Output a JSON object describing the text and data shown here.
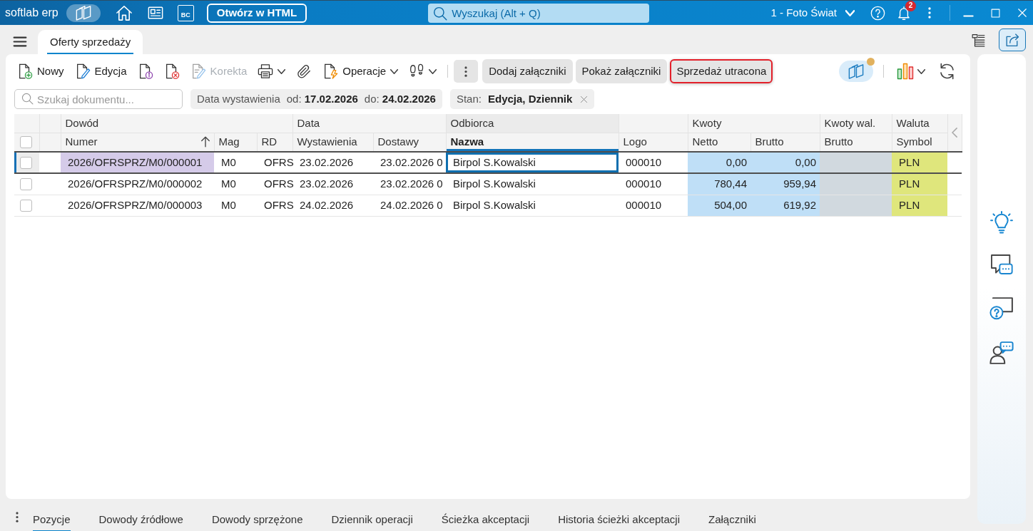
{
  "app_bar": {
    "logo": "softlab erp",
    "shortcut": "BC",
    "open_button": "Otwórz w HTML",
    "search": {
      "placeholder": "Wyszukaj (Alt + Q)"
    },
    "company": "1 - Foto Świat",
    "notification_count": "2"
  },
  "tabs": [
    {
      "label": "Oferty sprzedaży",
      "selected": true
    }
  ],
  "toolbar": {
    "tools": [
      {
        "kind": "button",
        "label": "Nowy",
        "disabled": false
      },
      {
        "kind": "button",
        "label": "Edycja",
        "disabled": false
      },
      {
        "kind": "button",
        "disabled": false
      },
      {
        "kind": "button",
        "disabled": false
      },
      {
        "kind": "button",
        "label": "Korekta",
        "disabled": true
      },
      {
        "kind": "dropdown",
        "disabled": false
      },
      {
        "kind": "button",
        "disabled": false
      },
      {
        "kind": "dropdown",
        "label": "Operacje",
        "disabled": false
      },
      {
        "kind": "dropdown",
        "disabled": false
      }
    ],
    "actions": [
      {
        "label": "Dodaj załączniki",
        "highlighted": false
      },
      {
        "label": "Pokaż załączniki",
        "highlighted": false
      },
      {
        "label": "Sprzedaż utracona",
        "highlighted": true
      }
    ]
  },
  "filter_bar": {
    "search": {
      "placeholder": "Szukaj dokumentu..."
    },
    "filters": [
      {
        "label": "Data wystawienia",
        "terms": [
          {
            "prefix": "od:",
            "value": "17.02.2026"
          },
          {
            "prefix": "do:",
            "value": "24.02.2026"
          }
        ],
        "removable": false
      },
      {
        "label": "Stan:",
        "terms": [
          {
            "value": "Edycja, Dziennik"
          }
        ],
        "removable": true
      }
    ]
  },
  "table": {
    "select_all": {
      "checked": false
    },
    "groups": [
      {
        "label": "Dowód",
        "columns": [
          {
            "label": "Numer",
            "kind": "text",
            "sorted": true,
            "focused": false
          },
          {
            "label": "Mag",
            "kind": "text",
            "sorted": false,
            "focused": false
          },
          {
            "label": "RD",
            "kind": "text",
            "sorted": false,
            "focused": false
          }
        ]
      },
      {
        "label": "Data",
        "columns": [
          {
            "label": "Wystawienia",
            "kind": "text",
            "sorted": false,
            "focused": false
          },
          {
            "label": "Dostawy",
            "kind": "text",
            "sorted": false,
            "focused": false
          }
        ]
      },
      {
        "label": "Odbiorca",
        "columns": [
          {
            "label": "Nazwa",
            "kind": "text",
            "sorted": false,
            "focused": true
          }
        ]
      },
      {
        "columns": [
          {
            "label": "Logo",
            "kind": "text",
            "sorted": false,
            "focused": false
          }
        ]
      },
      {
        "label": "Kwoty",
        "columns": [
          {
            "label": "Netto",
            "kind": "amount",
            "sorted": false,
            "focused": false,
            "color": "#bfdff7"
          },
          {
            "label": "Brutto",
            "kind": "amount",
            "sorted": false,
            "focused": false,
            "color": "#bfdff7"
          }
        ]
      },
      {
        "label": "Kwoty wal.",
        "columns": [
          {
            "label": "Brutto",
            "kind": "amount",
            "sorted": false,
            "focused": false,
            "color": "#d1d9df"
          }
        ]
      },
      {
        "label": "Waluta",
        "columns": [
          {
            "label": "Symbol",
            "kind": "text",
            "sorted": false,
            "focused": false,
            "color": "#dfe67c"
          }
        ]
      }
    ],
    "rows": [
      {
        "checked": false,
        "selected": true,
        "cells": [
          "2026/OFRSPRZ/M0/000001",
          "M0",
          "OFRS",
          "23.02.2026",
          "23.02.2026 0",
          "Birpol S.Kowalski",
          "000010",
          "0,00",
          "0,00",
          null,
          "PLN"
        ]
      },
      {
        "checked": false,
        "selected": false,
        "cells": [
          "2026/OFRSPRZ/M0/000002",
          "M0",
          "OFRS",
          "23.02.2026",
          "23.02.2026 0",
          "Birpol S.Kowalski",
          "000010",
          "780,44",
          "959,94",
          null,
          "PLN"
        ]
      },
      {
        "checked": false,
        "selected": false,
        "cells": [
          "2026/OFRSPRZ/M0/000003",
          "M0",
          "OFRS",
          "24.02.2026",
          "24.02.2026 0",
          "Birpol S.Kowalski",
          "000010",
          "504,00",
          "619,92",
          null,
          "PLN"
        ]
      }
    ]
  },
  "bottom_tabs": [
    {
      "label": "Pozycje",
      "selected": true
    },
    {
      "label": "Dowody źródłowe",
      "selected": false
    },
    {
      "label": "Dowody sprzężone",
      "selected": false
    },
    {
      "label": "Dziennik operacji",
      "selected": false
    },
    {
      "label": "Ścieżka akceptacji",
      "selected": false
    },
    {
      "label": "Historia ścieżki akceptacji",
      "selected": false
    },
    {
      "label": "Załączniki",
      "selected": false
    }
  ]
}
